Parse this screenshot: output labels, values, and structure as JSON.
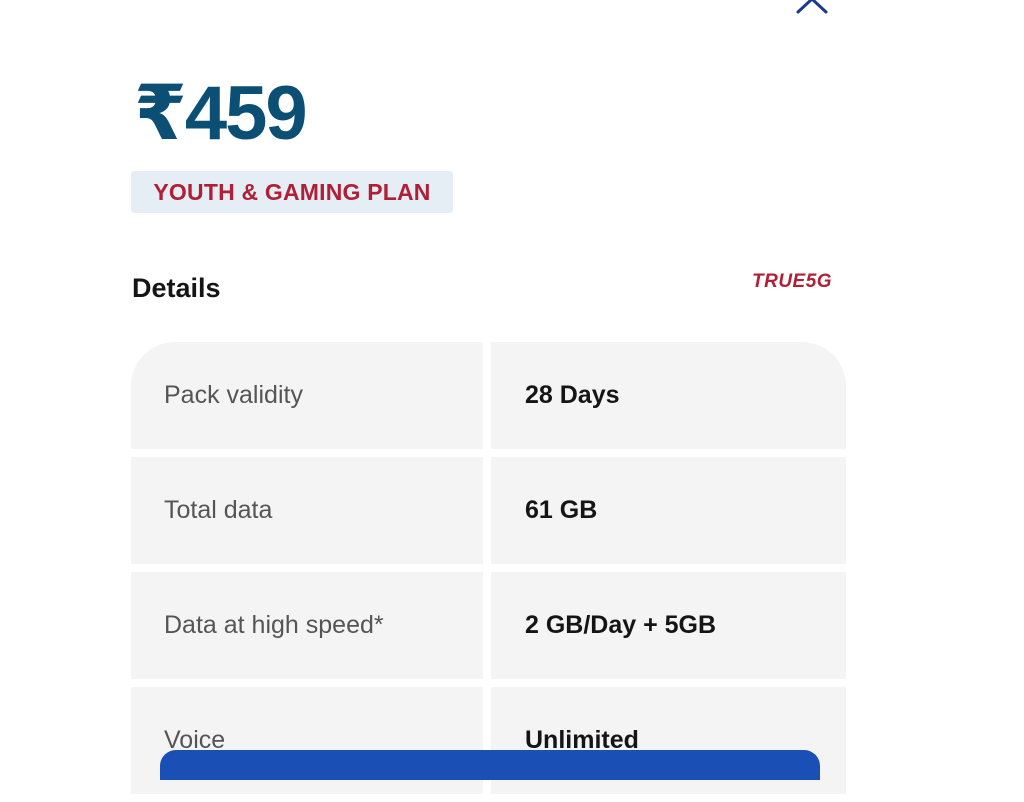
{
  "plan": {
    "price": "₹459",
    "badge": "YOUTH & GAMING PLAN"
  },
  "details": {
    "title": "Details",
    "network_tag": "TRUE5G",
    "rows": [
      {
        "label": "Pack validity",
        "value": "28 Days"
      },
      {
        "label": "Total data",
        "value": "61 GB"
      },
      {
        "label": "Data at high speed*",
        "value": "2 GB/Day + 5GB"
      },
      {
        "label": "Voice",
        "value": "Unlimited"
      }
    ]
  },
  "icons": {
    "close": "close-icon"
  },
  "colors": {
    "price": "#0b4f75",
    "badge_text": "#b01f36",
    "badge_bg": "#e4eef4",
    "accent_blue": "#1a4fb6"
  }
}
